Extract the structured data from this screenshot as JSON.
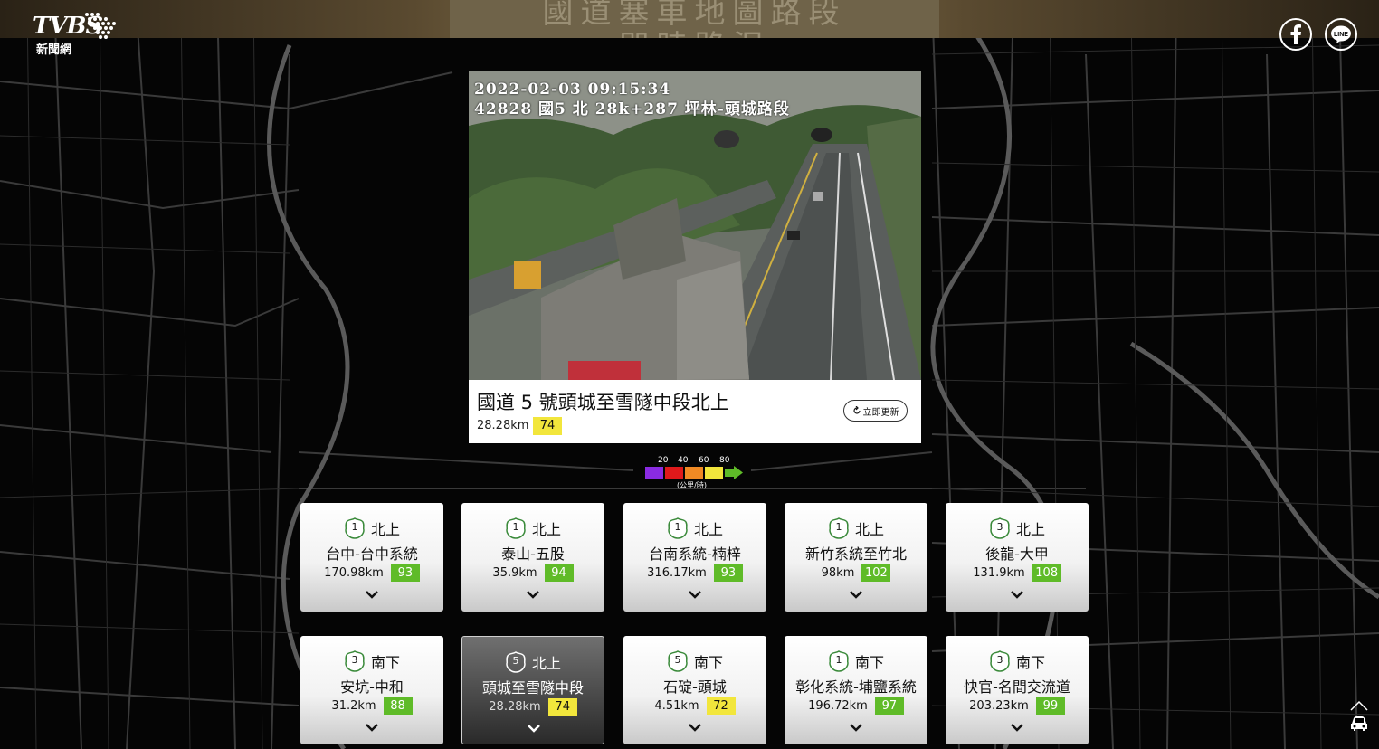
{
  "banner": {
    "line1": "國道塞車地圖路段",
    "line2": "即時路況"
  },
  "logo": {
    "brand": "TVBS",
    "subtitle": "新聞網"
  },
  "social": {
    "facebook_icon": "facebook-icon",
    "line_icon": "line-icon",
    "line_text": "LINE"
  },
  "camera": {
    "timestamp": "2022-02-03 09:15:34",
    "location_overlay": "42828 國5 北 28k+287 坪林-頭城路段",
    "title": "國道 5 號頭城至雪隧中段北上",
    "distance": "28.28km",
    "speed": "74",
    "refresh_label": "立即更新"
  },
  "legend": {
    "ticks": [
      "20",
      "40",
      "60",
      "80"
    ],
    "unit": "(公里/時)",
    "colors": [
      "#8a2be2",
      "#e0191b",
      "#f08a24",
      "#f2e63c",
      "#5fbb28"
    ]
  },
  "cards": [
    {
      "highway": "1",
      "direction": "北上",
      "route": "台中-台中系統",
      "distance": "170.98km",
      "speed": "93",
      "speed_color": "green"
    },
    {
      "highway": "1",
      "direction": "北上",
      "route": "泰山-五股",
      "distance": "35.9km",
      "speed": "94",
      "speed_color": "green"
    },
    {
      "highway": "1",
      "direction": "北上",
      "route": "台南系統-楠梓",
      "distance": "316.17km",
      "speed": "93",
      "speed_color": "green"
    },
    {
      "highway": "1",
      "direction": "北上",
      "route": "新竹系統至竹北",
      "distance": "98km",
      "speed": "102",
      "speed_color": "green"
    },
    {
      "highway": "3",
      "direction": "北上",
      "route": "後龍-大甲",
      "distance": "131.9km",
      "speed": "108",
      "speed_color": "green"
    },
    {
      "highway": "3",
      "direction": "南下",
      "route": "安坑-中和",
      "distance": "31.2km",
      "speed": "88",
      "speed_color": "green"
    },
    {
      "highway": "5",
      "direction": "北上",
      "route": "頭城至雪隧中段",
      "distance": "28.28km",
      "speed": "74",
      "speed_color": "yellow",
      "active": true
    },
    {
      "highway": "5",
      "direction": "南下",
      "route": "石碇-頭城",
      "distance": "4.51km",
      "speed": "72",
      "speed_color": "yellow"
    },
    {
      "highway": "1",
      "direction": "南下",
      "route": "彰化系統-埔鹽系統",
      "distance": "196.72km",
      "speed": "97",
      "speed_color": "green"
    },
    {
      "highway": "3",
      "direction": "南下",
      "route": "快官-名間交流道",
      "distance": "203.23km",
      "speed": "99",
      "speed_color": "green"
    }
  ]
}
